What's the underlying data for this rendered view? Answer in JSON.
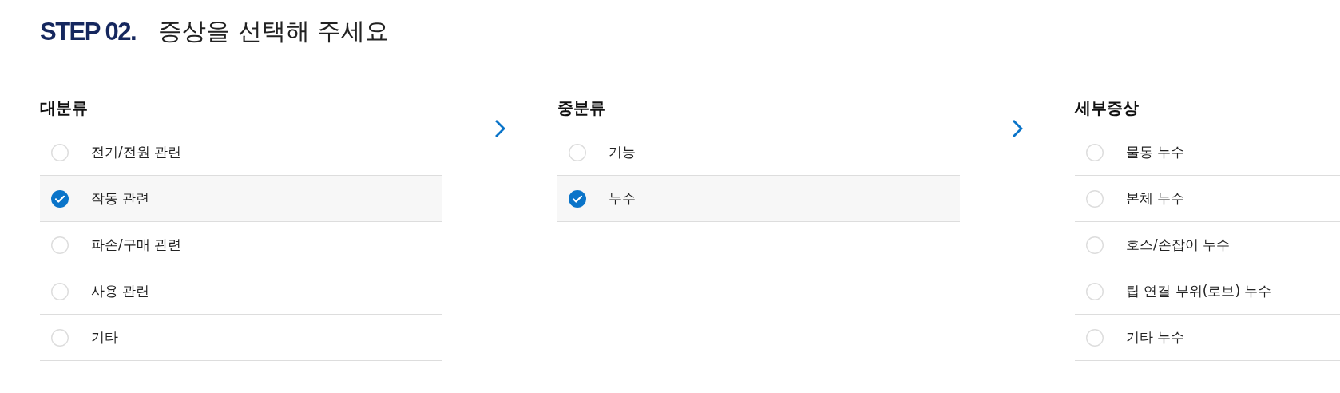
{
  "step": {
    "number": "STEP 02.",
    "title": "증상을 선택해 주세요"
  },
  "columns": [
    {
      "heading": "대분류",
      "options": [
        {
          "label": "전기/전원 관련",
          "selected": false
        },
        {
          "label": "작동 관련",
          "selected": true
        },
        {
          "label": "파손/구매 관련",
          "selected": false
        },
        {
          "label": "사용 관련",
          "selected": false
        },
        {
          "label": "기타",
          "selected": false
        }
      ]
    },
    {
      "heading": "중분류",
      "options": [
        {
          "label": "기능",
          "selected": false
        },
        {
          "label": "누수",
          "selected": true
        }
      ]
    },
    {
      "heading": "세부증상",
      "options": [
        {
          "label": "물통 누수",
          "selected": false
        },
        {
          "label": "본체 누수",
          "selected": false
        },
        {
          "label": "호스/손잡이 누수",
          "selected": false
        },
        {
          "label": "팁 연결 부위(로브) 누수",
          "selected": false
        },
        {
          "label": "기타 누수",
          "selected": false
        }
      ]
    }
  ]
}
